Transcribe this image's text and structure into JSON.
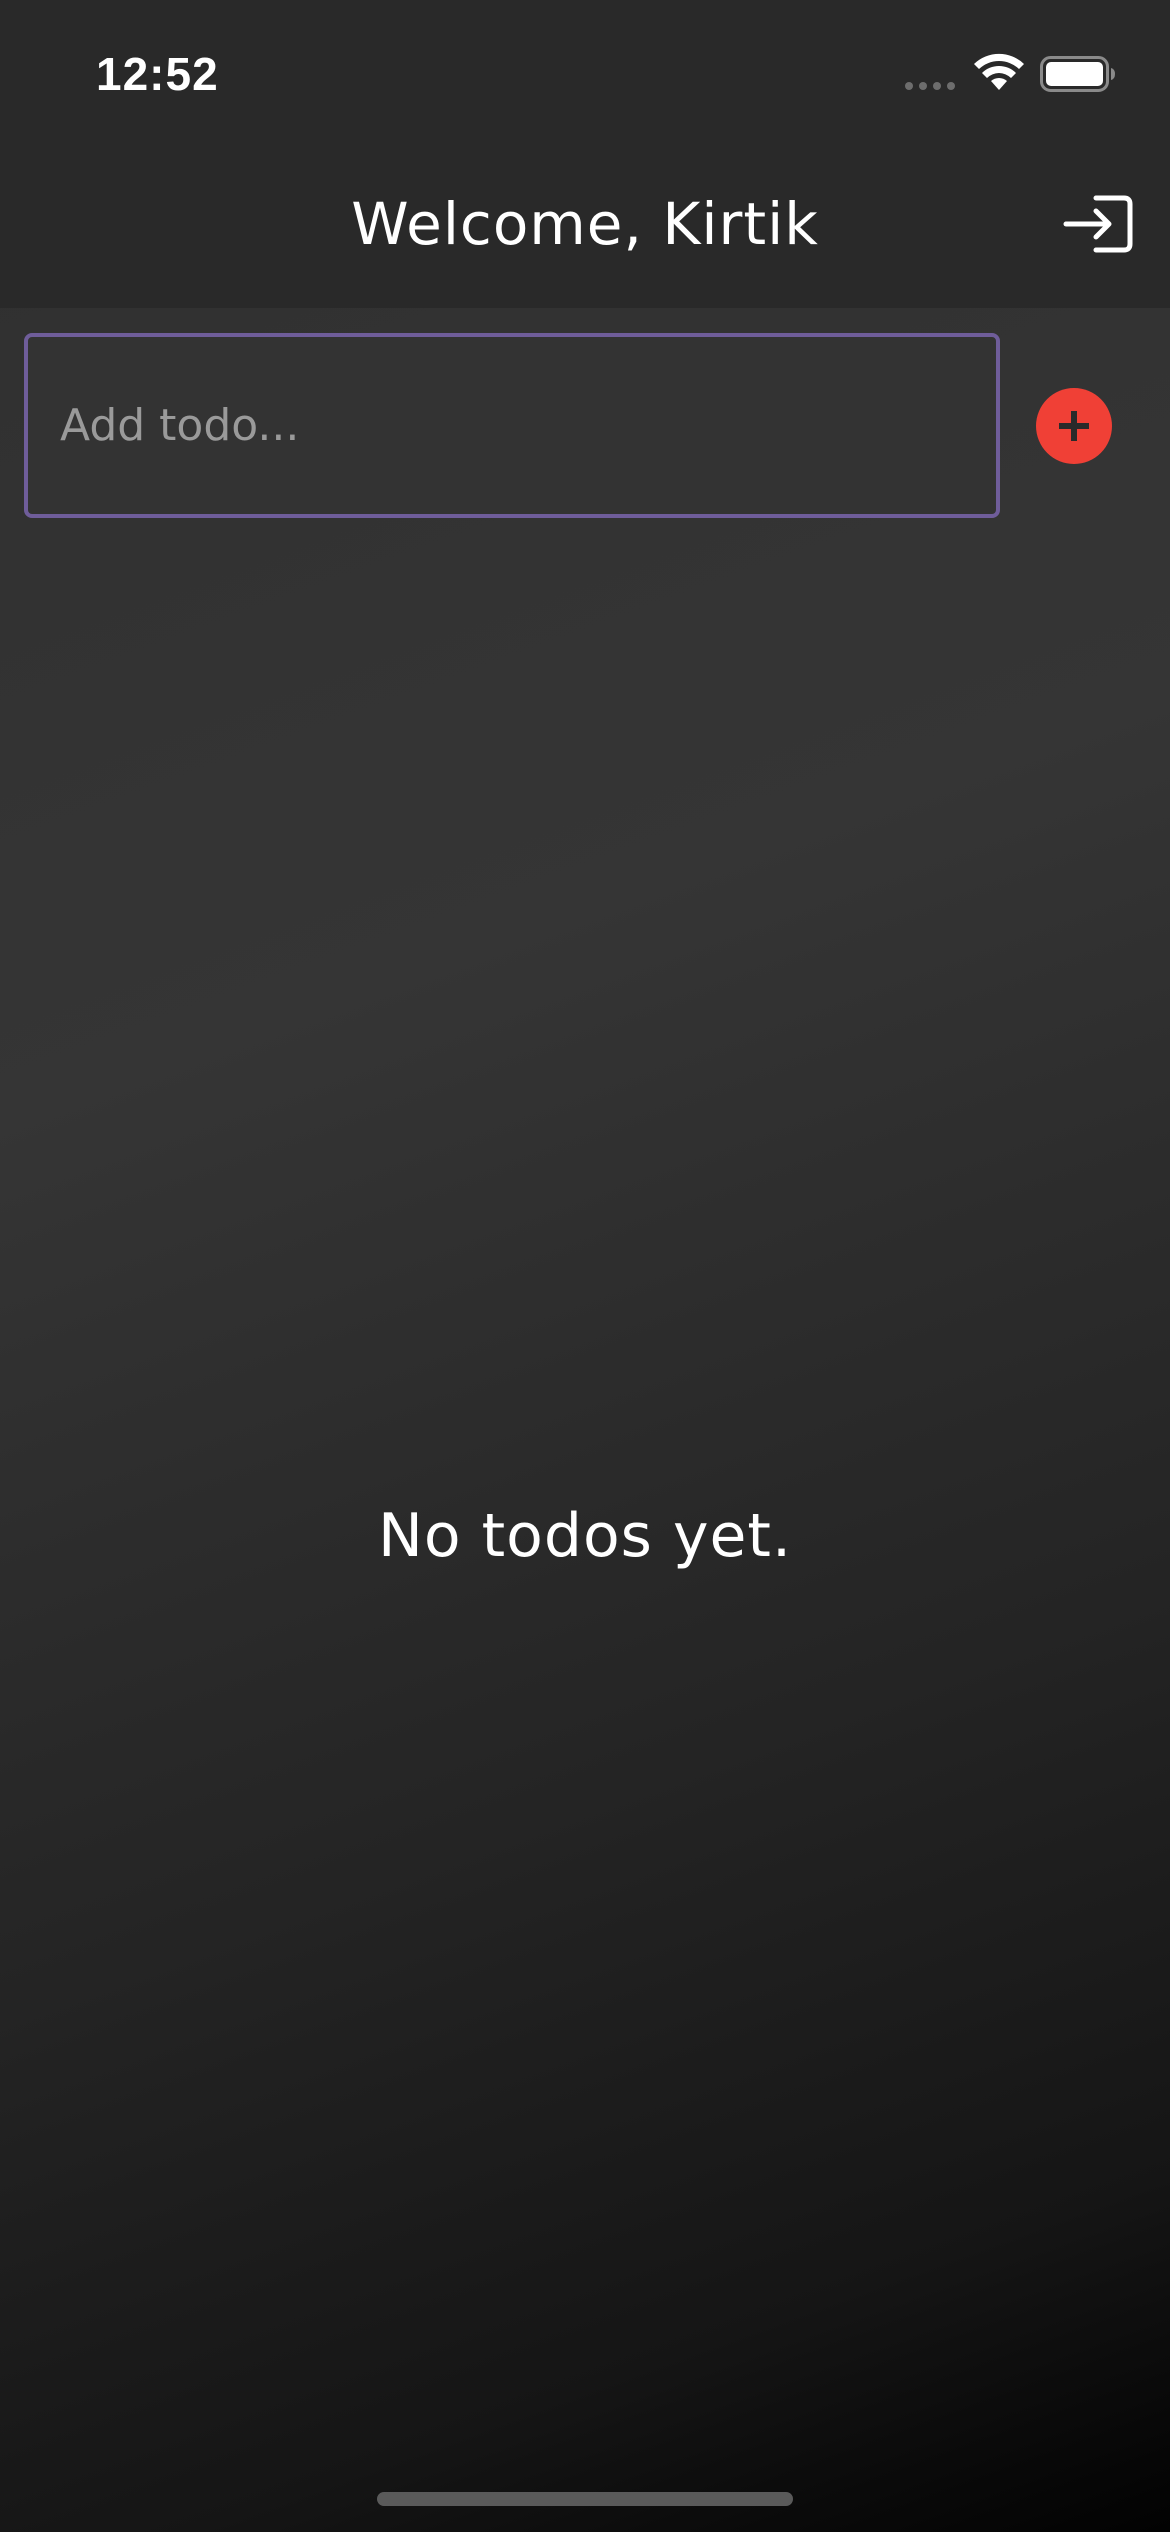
{
  "status_bar": {
    "time": "12:52"
  },
  "header": {
    "title": "Welcome, Kirtik",
    "logout_icon": "login-arrow-icon"
  },
  "todo_form": {
    "placeholder": "Add todo...",
    "value": "",
    "add_icon": "plus-circle-icon"
  },
  "todo_list": {
    "empty_message": "No todos yet.",
    "items": []
  },
  "colors": {
    "accent_border": "#6f5d9a",
    "add_button": "#f04036",
    "header_background": "#292929"
  }
}
